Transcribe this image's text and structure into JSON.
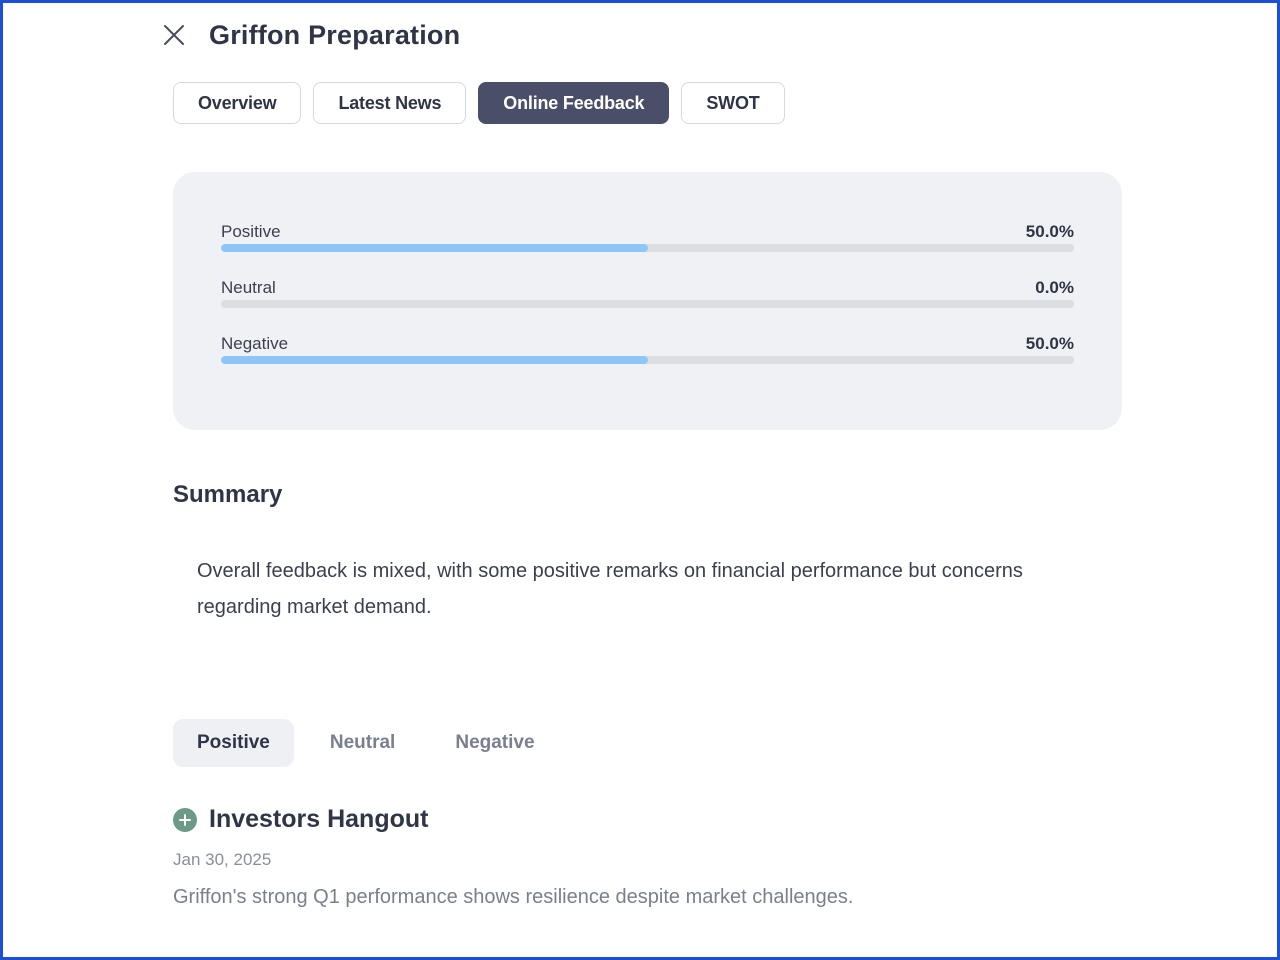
{
  "header": {
    "title": "Griffon Preparation"
  },
  "tabs": [
    {
      "label": "Overview",
      "active": false
    },
    {
      "label": "Latest News",
      "active": false
    },
    {
      "label": "Online Feedback",
      "active": true
    },
    {
      "label": "SWOT",
      "active": false
    }
  ],
  "sentiment": [
    {
      "label": "Positive",
      "value_text": "50.0%",
      "fraction": 0.5
    },
    {
      "label": "Neutral",
      "value_text": "0.0%",
      "fraction": 0.0
    },
    {
      "label": "Negative",
      "value_text": "50.0%",
      "fraction": 0.5
    }
  ],
  "summary": {
    "title": "Summary",
    "text": "Overall feedback is mixed, with some positive remarks on financial performance but concerns regarding market demand."
  },
  "filter_tabs": [
    {
      "label": "Positive",
      "active": true
    },
    {
      "label": "Neutral",
      "active": false
    },
    {
      "label": "Negative",
      "active": false
    }
  ],
  "feedback_items": [
    {
      "source": "Investors Hangout",
      "date": "Jan 30, 2025",
      "text": "Griffon's strong Q1 performance shows resilience despite market challenges.",
      "icon": "plus-circle-icon"
    }
  ],
  "colors": {
    "accent_tab": "#4a4e69",
    "bar_fill": "#8ec7f7",
    "positive_icon": "#6b9a87",
    "frame_border": "#1f4fd6"
  }
}
